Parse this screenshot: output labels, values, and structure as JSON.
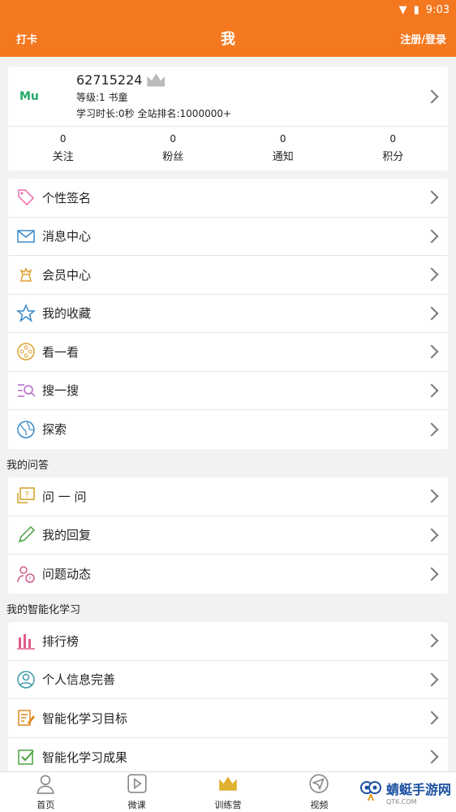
{
  "statusbar": {
    "time": "9:03"
  },
  "appbar": {
    "left": "打卡",
    "title": "我",
    "right": "注册/登录"
  },
  "profile": {
    "logo_text": "Mu",
    "user_id": "62715224",
    "level": "等级:1 书童",
    "study": "学习时长:0秒 全站排名:1000000+",
    "stats": [
      {
        "num": "0",
        "label": "关注"
      },
      {
        "num": "0",
        "label": "粉丝"
      },
      {
        "num": "0",
        "label": "通知"
      },
      {
        "num": "0",
        "label": "积分"
      }
    ]
  },
  "menu1": [
    {
      "label": "个性签名",
      "icon": "tag-icon"
    },
    {
      "label": "消息中心",
      "icon": "mail-icon"
    },
    {
      "label": "会员中心",
      "icon": "chess-king-icon"
    },
    {
      "label": "我的收藏",
      "icon": "star-icon"
    },
    {
      "label": "看一看",
      "icon": "film-reel-icon"
    },
    {
      "label": "搜一搜",
      "icon": "search-list-icon"
    },
    {
      "label": "探索",
      "icon": "globe-icon"
    }
  ],
  "section_qa": "我的问答",
  "menu2": [
    {
      "label": "问 一 问",
      "icon": "question-bubble-icon"
    },
    {
      "label": "我的回复",
      "icon": "pencil-icon"
    },
    {
      "label": "问题动态",
      "icon": "user-question-icon"
    }
  ],
  "section_learning": "我的智能化学习",
  "menu3": [
    {
      "label": "排行榜",
      "icon": "bar-chart-icon"
    },
    {
      "label": "个人信息完善",
      "icon": "user-circle-icon"
    },
    {
      "label": "智能化学习目标",
      "icon": "edit-doc-icon"
    },
    {
      "label": "智能化学习成果",
      "icon": "checkbox-icon"
    }
  ],
  "tabs": [
    {
      "label": "首页",
      "icon": "person-icon"
    },
    {
      "label": "微课",
      "icon": "play-icon"
    },
    {
      "label": "训练营",
      "icon": "crown-icon"
    },
    {
      "label": "视频",
      "icon": "navigation-icon"
    }
  ],
  "watermark": {
    "text": "蜻蜓手游网",
    "sub": "QT6.COM"
  },
  "colors": {
    "primary": "#f47820",
    "background": "#f2f2f2"
  }
}
